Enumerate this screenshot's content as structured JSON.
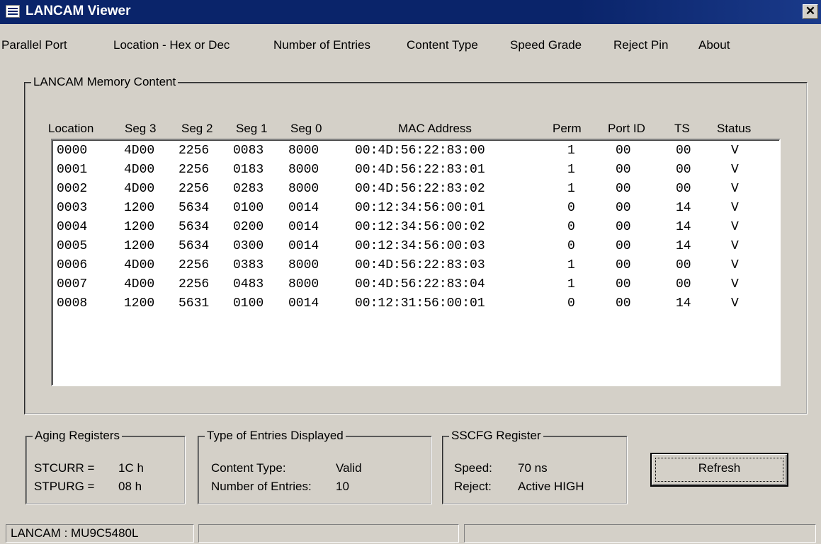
{
  "window": {
    "title": "LANCAM Viewer",
    "close_glyph": "✕",
    "icon": "app-window-icon"
  },
  "menu": [
    "Parallel Port",
    "Location - Hex or Dec",
    "Number of Entries",
    "Content Type",
    "Speed Grade",
    "Reject Pin",
    "About"
  ],
  "memory": {
    "legend": "LANCAM Memory Content",
    "columns": [
      "Location",
      "Seg 3",
      "Seg 2",
      "Seg 1",
      "Seg 0",
      "MAC Address",
      "Perm",
      "Port ID",
      "TS",
      "Status"
    ],
    "rows": [
      [
        "0000",
        "4D00",
        "2256",
        "0083",
        "8000",
        "00:4D:56:22:83:00",
        "1",
        "00",
        "00",
        "V"
      ],
      [
        "0001",
        "4D00",
        "2256",
        "0183",
        "8000",
        "00:4D:56:22:83:01",
        "1",
        "00",
        "00",
        "V"
      ],
      [
        "0002",
        "4D00",
        "2256",
        "0283",
        "8000",
        "00:4D:56:22:83:02",
        "1",
        "00",
        "00",
        "V"
      ],
      [
        "0003",
        "1200",
        "5634",
        "0100",
        "0014",
        "00:12:34:56:00:01",
        "0",
        "00",
        "14",
        "V"
      ],
      [
        "0004",
        "1200",
        "5634",
        "0200",
        "0014",
        "00:12:34:56:00:02",
        "0",
        "00",
        "14",
        "V"
      ],
      [
        "0005",
        "1200",
        "5634",
        "0300",
        "0014",
        "00:12:34:56:00:03",
        "0",
        "00",
        "14",
        "V"
      ],
      [
        "0006",
        "4D00",
        "2256",
        "0383",
        "8000",
        "00:4D:56:22:83:03",
        "1",
        "00",
        "00",
        "V"
      ],
      [
        "0007",
        "4D00",
        "2256",
        "0483",
        "8000",
        "00:4D:56:22:83:04",
        "1",
        "00",
        "00",
        "V"
      ],
      [
        "0008",
        "1200",
        "5631",
        "0100",
        "0014",
        "00:12:31:56:00:01",
        "0",
        "00",
        "14",
        "V"
      ]
    ]
  },
  "aging": {
    "legend": "Aging Registers",
    "stcurr_label": "STCURR =",
    "stcurr_value": "1C h",
    "stpurg_label": "STPURG =",
    "stpurg_value": "08 h"
  },
  "entries": {
    "legend": "Type of Entries Displayed",
    "content_label": "Content Type:",
    "content_value": "Valid",
    "count_label": "Number of Entries:",
    "count_value": "10"
  },
  "sscfg": {
    "legend": "SSCFG Register",
    "speed_label": "Speed:",
    "speed_value": "70 ns",
    "reject_label": "Reject:",
    "reject_value": "Active HIGH"
  },
  "refresh_label": "Refresh",
  "status": {
    "device": "LANCAM : MU9C5480L",
    "panel2": "",
    "panel3": ""
  }
}
